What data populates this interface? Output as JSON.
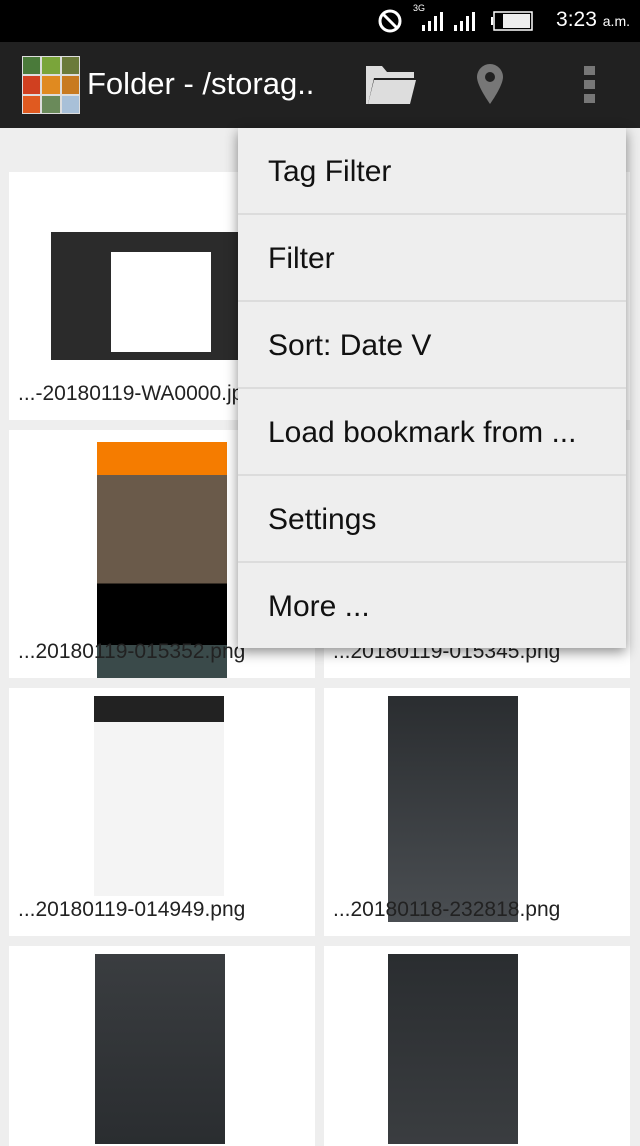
{
  "status_bar": {
    "network": "3G",
    "time": "3:23",
    "ampm": "a.m."
  },
  "toolbar": {
    "title": "Folder - /storag..",
    "icons": [
      "folder-icon",
      "location-pin-icon",
      "overflow-menu-icon"
    ]
  },
  "files": [
    {
      "name": "...-20180119-WA0000.jpg"
    },
    {
      "name": "...20180119-015352.png"
    },
    {
      "name": "...20180119-015345.png"
    },
    {
      "name": "...20180119-014949.png"
    },
    {
      "name": "...20180118-232818.png"
    },
    {
      "name": ""
    },
    {
      "name": ""
    }
  ],
  "menu": {
    "items": [
      "Tag Filter",
      "Filter",
      "Sort: Date V",
      "Load bookmark from ...",
      "Settings",
      "More ..."
    ]
  },
  "colors": {
    "toolbar": "#212121",
    "status": "#000000",
    "menu": "#eeeeee"
  }
}
